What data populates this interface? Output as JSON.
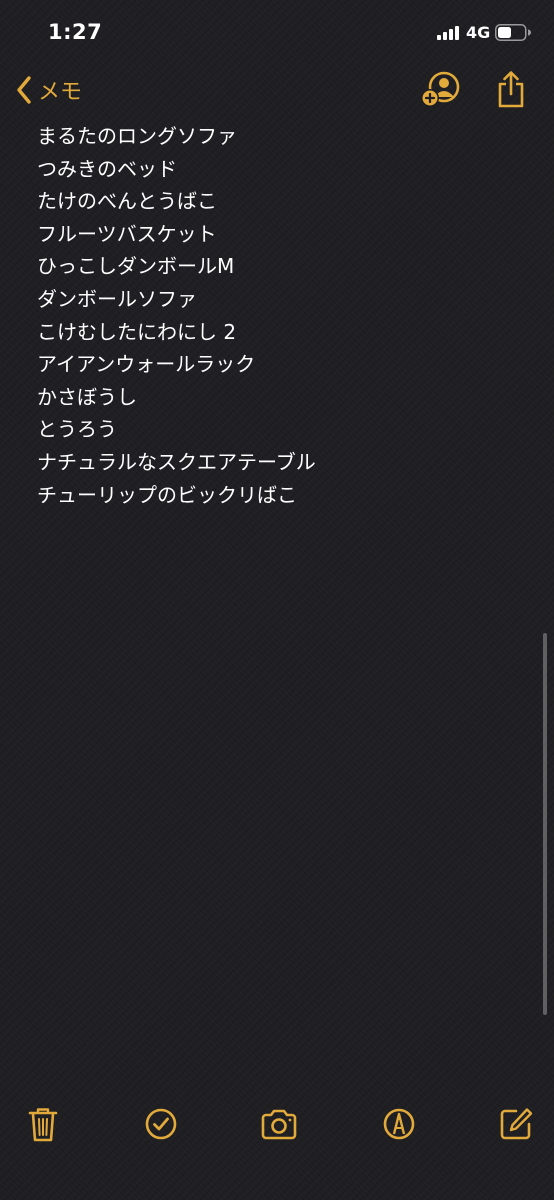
{
  "status_bar": {
    "time": "1:27",
    "network": "4G"
  },
  "nav": {
    "back_label": "メモ",
    "icons": [
      "chevron-left-icon",
      "add-person-icon",
      "share-icon"
    ],
    "accent_color": "#e2a93b"
  },
  "note": {
    "lines": [
      "まるたのロングソファ",
      "つみきのベッド",
      "たけのべんとうばこ",
      "フルーツバスケット",
      "ひっこしダンボールM",
      "ダンボールソファ",
      "こけむしたにわにし 2",
      "アイアンウォールラック",
      "かさぼうし",
      "とうろう",
      "ナチュラルなスクエアテーブル",
      "チューリップのビックリばこ"
    ],
    "text_color": "#ffffff",
    "background_color": "#1d1d21"
  },
  "toolbar": {
    "icons": [
      "trash-icon",
      "checklist-icon",
      "camera-icon",
      "markup-pen-icon",
      "compose-icon"
    ]
  }
}
